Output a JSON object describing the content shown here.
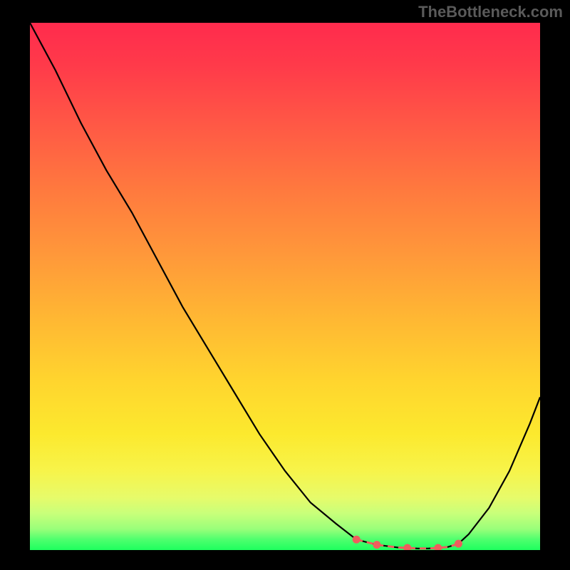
{
  "attribution": "TheBottleneck.com",
  "chart_data": {
    "type": "line",
    "title": "",
    "xlabel": "",
    "ylabel": "",
    "x": [
      0,
      5,
      10,
      15,
      20,
      25,
      30,
      35,
      40,
      45,
      50,
      55,
      60,
      64,
      68,
      72,
      74,
      76,
      78,
      80,
      82,
      84,
      86,
      90,
      94,
      98,
      100
    ],
    "values": [
      100,
      91,
      81,
      72,
      64,
      55,
      46,
      38,
      30,
      22,
      15,
      9,
      5,
      2,
      1,
      0.5,
      0.4,
      0.3,
      0.3,
      0.4,
      0.6,
      1.2,
      3,
      8,
      15,
      24,
      29
    ],
    "xlim": [
      0,
      100
    ],
    "ylim": [
      0,
      100
    ],
    "highlight_range_x": [
      64,
      84
    ],
    "annotations": "Gradient background from red (top) through orange/yellow to green (bottom); highlighted minimum region shown with salmon dashed segment and dots near x≈64–84"
  }
}
